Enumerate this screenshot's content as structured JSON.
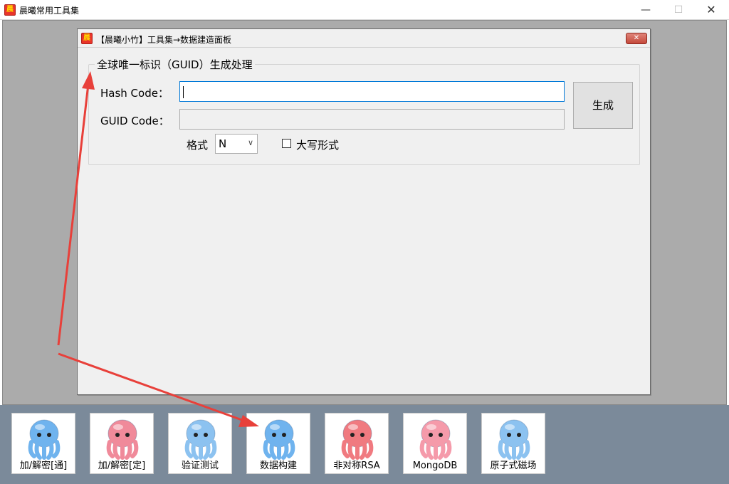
{
  "window": {
    "title": "晨曦常用工具集",
    "min_glyph": "—",
    "max_glyph": "☐",
    "close_glyph": "✕"
  },
  "child": {
    "title": "【晨曦小竹】工具集→数据建造面板",
    "close_glyph": "✕",
    "group_title": "全球唯一标识（GUID）生成处理",
    "hash_label": "Hash Code：",
    "hash_value": "",
    "guid_label": "GUID Code：",
    "guid_value": "",
    "generate_label": "生成",
    "format_label": "格式",
    "format_value": "N",
    "format_chevron": "∨",
    "uppercase_label": "大写形式",
    "uppercase_checked": false
  },
  "toolbar": {
    "items": [
      {
        "label": "加/解密[通]",
        "icon": "octopus-sunglasses-icon",
        "color": "#6fb3ee"
      },
      {
        "label": "加/解密[定]",
        "icon": "octopus-pink-sunglasses-icon",
        "color": "#f08a9a"
      },
      {
        "label": "验证测试",
        "icon": "octopus-glasses-icon",
        "color": "#8cc2f0"
      },
      {
        "label": "数据构建",
        "icon": "octopus-wink-icon",
        "color": "#6fb3ee"
      },
      {
        "label": "非对称RSA",
        "icon": "octopus-red-icon",
        "color": "#f07a80"
      },
      {
        "label": "MongoDB",
        "icon": "octopus-pink-icon",
        "color": "#f59aaa"
      },
      {
        "label": "原子式磁场",
        "icon": "octopus-dizzy-icon",
        "color": "#8cc2f0"
      }
    ]
  },
  "colors": {
    "mdi_background": "#ababab",
    "toolbar_background": "#7b8a9a",
    "annotation_arrow": "#e8403a"
  }
}
